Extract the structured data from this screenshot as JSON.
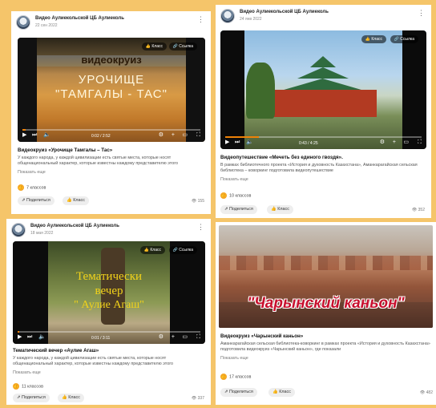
{
  "colors": {
    "background": "#f5c56a",
    "accent": "#ee8208"
  },
  "icons": {
    "more": "three-dots-icon",
    "class": "thumbs-up-icon",
    "link": "link-icon",
    "share": "share-icon",
    "views": "eye-icon",
    "play": "play-icon",
    "next": "next-icon",
    "volume": "volume-icon",
    "settings": "gear-icon",
    "add": "plus-icon",
    "miniplayer": "miniplayer-icon",
    "fullscreen": "fullscreen-icon"
  },
  "posts": [
    {
      "channel": "Видео Аулиекольской ЦБ Аулиеколь",
      "date": "22 сен 2022",
      "video": {
        "overlay_line1": "видеокруиз",
        "overlay_line2": "УРОЧИЩЕ",
        "overlay_line3": "\"ТАМГАЛЫ - ТАС\"",
        "class_btn": "Класс",
        "link_btn": "Ссылка",
        "time": "0:02 / 2:52",
        "progress": 0.02
      },
      "title": "Видеокруиз «Урочище Тамгалы – Тас»",
      "description": "У каждого народа, у каждой цивилизации есть святые места, которые носят общенациональный характер, которые известны каждому представителю этого",
      "show_more": "Показать еще",
      "classes": "7 классов",
      "share": "Поделиться",
      "class": "Класс",
      "views": "155"
    },
    {
      "channel": "Видео Аулиекольской ЦБ Аулиеколь",
      "date": "24 янв 2022",
      "video": {
        "class_btn": "Класс",
        "link_btn": "Ссылка",
        "time": "0:43 / 4:25",
        "progress": 0.17
      },
      "title": "Видеопутешествие «Мечеть без единого гвоздя».",
      "description": "В рамках библиотечного проекта «История и духовность Казахстана», Аманкарагайская сельская библиотека – коворкинг подготовила видеопутешествие",
      "show_more": "Показать еще",
      "classes": "10 классов",
      "share": "Поделиться",
      "class": "Класс",
      "views": "352"
    },
    {
      "channel": "Видео Аулиекольской ЦБ Аулиеколь",
      "date": "18 мая 2022",
      "video": {
        "overlay_line1": "Тематически",
        "overlay_line2": "вечер",
        "overlay_line3": "\" Аулие Агаш\"",
        "class_btn": "Класс",
        "link_btn": "Ссылка",
        "time": "0:01 / 3:11",
        "progress": 0.01
      },
      "title": "Тематический вечер «Аулие Агаш»",
      "description": "У каждого народа, у каждой цивилизации есть святые места, которые носят общенациональный характер, которые известны каждому представителю этого",
      "show_more": "Показать еще",
      "classes": "11 классов",
      "share": "Поделиться",
      "class": "Класс",
      "views": "337"
    },
    {
      "video": {
        "overlay_line1": "\"Чарынский каньон\""
      },
      "title": "Видеокруиз «Чарынский каньон»",
      "description": "Аманкарагайская сельская библиотека-коворкинг в рамках проекта «История и духовность Казахстана» подготовила видеокруиз «Чарынский каньон», где показали",
      "show_more": "Показать еще",
      "classes": "17 классов",
      "share": "Поделиться",
      "class": "Класс",
      "views": "482"
    }
  ]
}
